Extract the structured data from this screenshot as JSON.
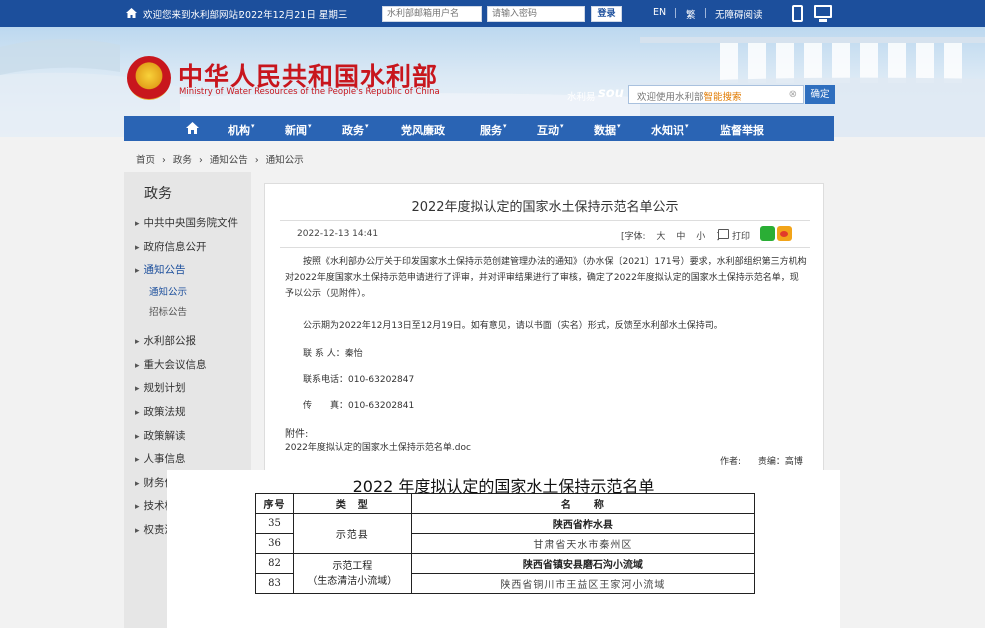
{
  "topbar": {
    "welcome": "欢迎您来到水利部网站!",
    "date": "2022年12月21日 星期三",
    "username_placeholder": "水利部邮箱用户名",
    "password_placeholder": "请输入密码",
    "login_label": "登录",
    "lang_en": "EN",
    "lang_tc": "繁",
    "accessible": "无障碍阅读"
  },
  "banner": {
    "title": "中华人民共和国水利部",
    "subtitle": "Ministry of Water Resources of the People's Republic of China",
    "search_label": "水利易",
    "search_logo": "sou",
    "search_placeholder_prefix": "欢迎使用水利部",
    "search_placeholder_highlight": "智能搜索",
    "search_button": "确定"
  },
  "nav": {
    "items": [
      "机构",
      "新闻",
      "政务",
      "党风廉政",
      "服务",
      "互动",
      "数据",
      "水知识",
      "监督举报"
    ],
    "caret": "▾"
  },
  "breadcrumb": [
    "首页",
    "›",
    "政务",
    "›",
    "通知公告",
    "›",
    "通知公示"
  ],
  "sidebar": {
    "title": "政务",
    "items": [
      "中共中央国务院文件",
      "政府信息公开",
      "通知公告",
      "水利部公报",
      "重大会议信息",
      "规划计划",
      "政策法规",
      "政策解读",
      "人事信息",
      "财务信息",
      "技术标准",
      "权责清单"
    ],
    "subs": [
      "通知公示",
      "招标公告"
    ]
  },
  "article": {
    "title": "2022年度拟认定的国家水土保持示范名单公示",
    "date": "2022-12-13 14:41",
    "font_label": "[字体:",
    "font_large": "大",
    "font_medium": "中",
    "font_small": "小",
    "font_close": "]",
    "print": "打印",
    "para1": "按照《水利部办公厅关于印发国家水土保持示范创建管理办法的通知》（办水保〔2021〕171号）要求，水利部组织第三方机构对2022年度国家水土保持示范申请进行了评审，并对评审结果进行了审核，确定了2022年度拟认定的国家水土保持示范名单，现予以公示（见附件）。",
    "para2": "公示期为2022年12月13日至12月19日。如有意见，请以书面（实名）形式，反馈至水利部水土保持司。",
    "contact": "联 系 人：秦怡",
    "phone": "联系电话：010-63202847",
    "fax": "传　　真：010-63202841",
    "attach_label": "附件:",
    "attach_file": "2022年度拟认定的国家水土保持示范名单.doc",
    "author": "作者:",
    "editor": "责编：高博"
  },
  "overlay": {
    "title": "2022 年度拟认定的国家水土保持示范名单",
    "headers": [
      "序号",
      "类　型",
      "名　　称"
    ],
    "type_county": "示范县",
    "type_project_1": "示范工程",
    "type_project_2": "（生态清洁小流域）",
    "rows": [
      {
        "no": "35",
        "name": "陕西省柞水县"
      },
      {
        "no": "36",
        "name": "甘肃省天水市秦州区"
      },
      {
        "no": "82",
        "name": "陕西省镇安县磨石沟小流域"
      },
      {
        "no": "83",
        "name": "陕西省铜川市王益区王家河小流域"
      }
    ]
  },
  "colors": {
    "topbar": "#1c4f9c",
    "nav": "#2a64b4",
    "title_red": "#c8161d",
    "link_blue": "#1c4f9c"
  }
}
